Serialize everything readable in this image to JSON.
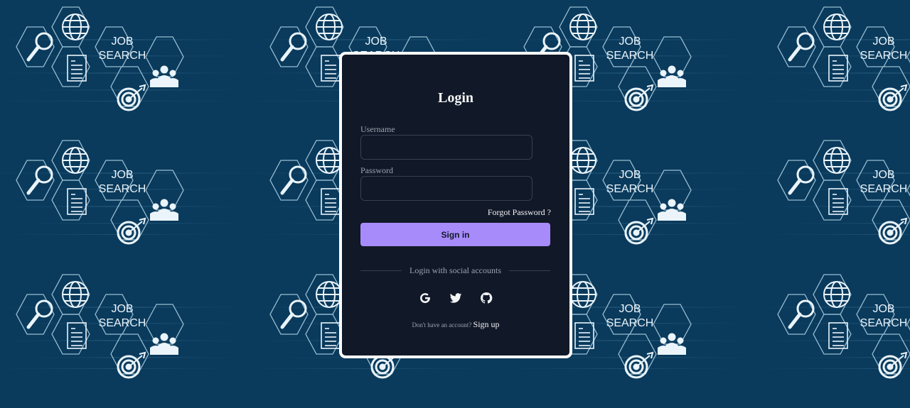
{
  "colors": {
    "background": "#0a3a5c",
    "card": "#111827",
    "card_border": "#ffffff",
    "accent": "#a78bfa",
    "muted_text": "#9ca3af",
    "text": "#f3f4f6"
  },
  "background": {
    "tile_text_line1": "JOB",
    "tile_text_line2": "SEARCH",
    "icons": [
      "globe-icon",
      "magnifier-icon",
      "checklist-icon",
      "team-icon",
      "target-icon"
    ]
  },
  "login": {
    "title": "Login",
    "username_label": "Username",
    "username_value": "",
    "password_label": "Password",
    "password_value": "",
    "forgot_link": "Forgot Password ?",
    "signin_button": "Sign in",
    "social_divider_text": "Login with social accounts",
    "social_icons": [
      "google-icon",
      "twitter-icon",
      "github-icon"
    ],
    "signup_prompt": "Don't have an account?",
    "signup_link": "Sign up"
  }
}
